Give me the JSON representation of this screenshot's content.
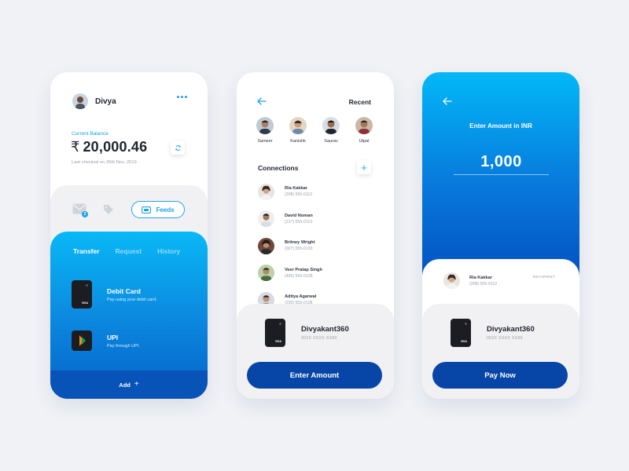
{
  "colors": {
    "accent": "#1ea3ea",
    "primary_button": "#0745a6",
    "gradient_top": "#0ab8f6",
    "gradient_bottom": "#0562c8",
    "background": "#f0f2f6"
  },
  "wallet_screen": {
    "user_name": "Divya",
    "balance_label": "Current Balance",
    "currency_symbol": "₹",
    "balance": "20,000.46",
    "last_checked": "Last checked on 26th Nov, 2019",
    "mail_badge": "2",
    "feeds_label": "Feeds",
    "tabs": [
      {
        "label": "Transfer",
        "active": true
      },
      {
        "label": "Request",
        "active": false
      },
      {
        "label": "History",
        "active": false
      }
    ],
    "payment_methods": [
      {
        "title": "Debit Card",
        "subtitle": "Pay using your debit card.",
        "icon": "visa-card"
      },
      {
        "title": "UPI",
        "subtitle": "Pay through UPI.",
        "icon": "upi-logo"
      }
    ],
    "card_brand": "VISA",
    "add_label": "Add",
    "add_icon": "+"
  },
  "contacts_screen": {
    "recent_title": "Recent",
    "recent": [
      {
        "name": "Sameer"
      },
      {
        "name": "Kanishk"
      },
      {
        "name": "Saurav"
      },
      {
        "name": "Utpal"
      }
    ],
    "connections_title": "Connections",
    "add_icon": "+",
    "connections": [
      {
        "name": "Ria Kakkar",
        "phone": "(208) 555-0112"
      },
      {
        "name": "David Noman",
        "phone": "(217) 555-0113"
      },
      {
        "name": "Britney Wright",
        "phone": "(307) 555-0133"
      },
      {
        "name": "Veer Pratap Singh",
        "phone": "(405) 555-0128"
      },
      {
        "name": "Aditya Agarwal",
        "phone": "(239) 555-0108"
      }
    ],
    "card_holder": "Divyakant360",
    "card_number": "002X XXXX XX89",
    "card_brand": "VISA",
    "button_label": "Enter Amount"
  },
  "amount_screen": {
    "title": "Enter Amount in INR",
    "amount": "1,000",
    "recipient": {
      "name": "Ria Kakkar",
      "phone": "(208) 555-0112",
      "tag": "RECIPIENT"
    },
    "card_holder": "Divyakant360",
    "card_number": "002X XXXX XX89",
    "card_brand": "VISA",
    "button_label": "Pay Now"
  }
}
